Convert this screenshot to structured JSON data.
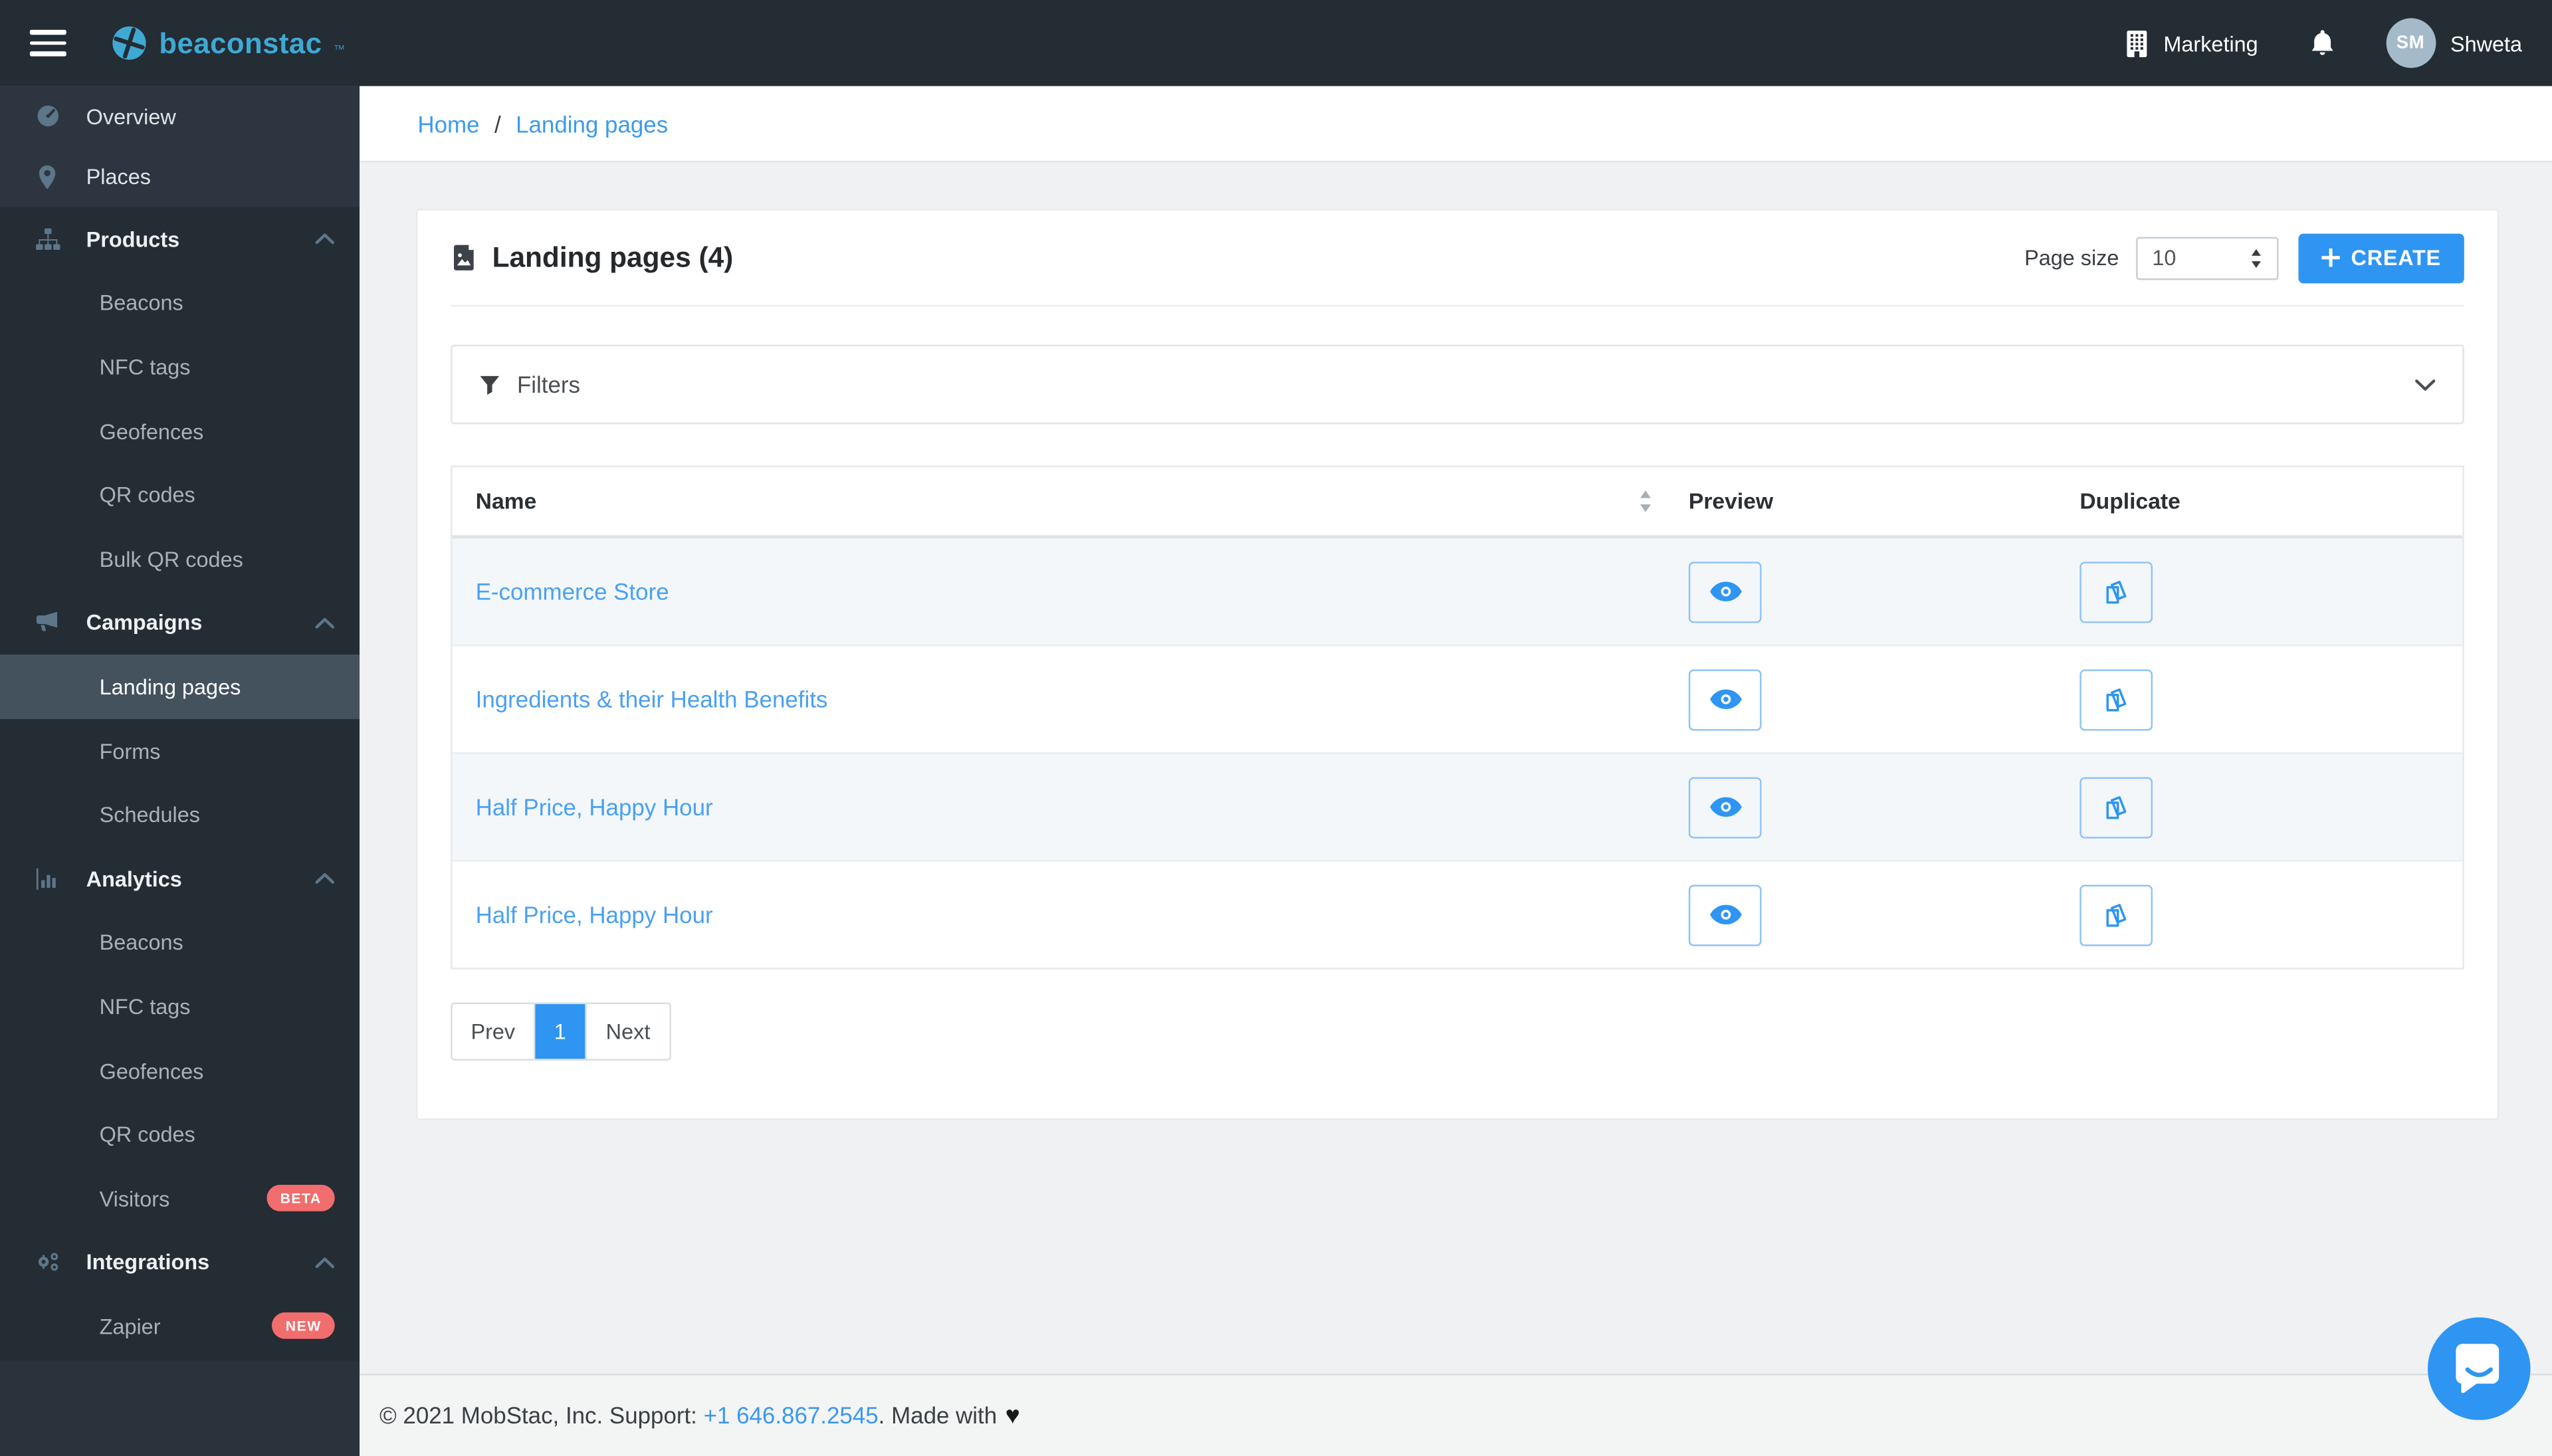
{
  "topbar": {
    "brand": "beaconstac",
    "brand_tm": "™",
    "org_label": "Marketing",
    "user_initials": "SM",
    "user_name": "Shweta"
  },
  "sidebar": {
    "top_items": [
      {
        "label": "Overview",
        "icon": "dashboard-icon"
      },
      {
        "label": "Places",
        "icon": "map-pin-icon"
      }
    ],
    "sections": [
      {
        "label": "Products",
        "icon": "sitemap-icon",
        "expanded": true,
        "items": [
          {
            "label": "Beacons"
          },
          {
            "label": "NFC tags"
          },
          {
            "label": "Geofences"
          },
          {
            "label": "QR codes"
          },
          {
            "label": "Bulk QR codes"
          }
        ]
      },
      {
        "label": "Campaigns",
        "icon": "megaphone-icon",
        "expanded": true,
        "items": [
          {
            "label": "Landing pages",
            "active": true
          },
          {
            "label": "Forms"
          },
          {
            "label": "Schedules"
          }
        ]
      },
      {
        "label": "Analytics",
        "icon": "bar-chart-icon",
        "expanded": true,
        "items": [
          {
            "label": "Beacons"
          },
          {
            "label": "NFC tags"
          },
          {
            "label": "Geofences"
          },
          {
            "label": "QR codes"
          },
          {
            "label": "Visitors",
            "badge": "BETA"
          }
        ]
      },
      {
        "label": "Integrations",
        "icon": "gears-icon",
        "expanded": true,
        "items": [
          {
            "label": "Zapier",
            "badge": "NEW"
          }
        ]
      }
    ]
  },
  "breadcrumb": {
    "items": [
      "Home",
      "Landing pages"
    ],
    "separator": "/"
  },
  "page": {
    "title": "Landing pages (4)",
    "title_icon": "image-file-icon"
  },
  "toolbar": {
    "page_size_label": "Page size",
    "page_size_value": "10",
    "create_label": "CREATE"
  },
  "filters": {
    "label": "Filters"
  },
  "table": {
    "columns": [
      "Name",
      "Preview",
      "Duplicate"
    ],
    "rows": [
      {
        "name": "E-commerce Store"
      },
      {
        "name": "Ingredients & their Health Benefits"
      },
      {
        "name": "Half Price, Happy Hour"
      },
      {
        "name": "Half Price, Happy Hour"
      }
    ]
  },
  "pagination": {
    "prev": "Prev",
    "current": "1",
    "next": "Next"
  },
  "footer": {
    "copyright": "© 2021 MobStac, Inc. Support: ",
    "phone": "+1 646.867.2545",
    "suffix": ". Made with",
    "heart": "♥"
  },
  "icons": [
    "menu-icon",
    "brand-mark-icon",
    "building-icon",
    "bell-icon",
    "dashboard-icon",
    "map-pin-icon",
    "sitemap-icon",
    "megaphone-icon",
    "bar-chart-icon",
    "gears-icon",
    "chevron-up-icon",
    "chevron-down-icon",
    "image-file-icon",
    "plus-icon",
    "funnel-icon",
    "sort-icon",
    "stepper-icon",
    "eye-icon",
    "copy-icon",
    "chat-bubble-icon",
    "heart-icon"
  ],
  "colors": {
    "topbar_bg": "#242c34",
    "sidebar_top_bg": "#2d3640",
    "selected_item_bg": "#44525e",
    "accent_blue": "#2e95f3",
    "link_blue": "#4aa0f2",
    "breadcrumb_blue": "#3c9bee",
    "logo_blue": "#3fa9d4",
    "badge_red": "#f26d6d",
    "avatar_bg": "#a5bac9",
    "row_tint": "#f3f7fa",
    "main_bg": "#f0f1f2"
  }
}
